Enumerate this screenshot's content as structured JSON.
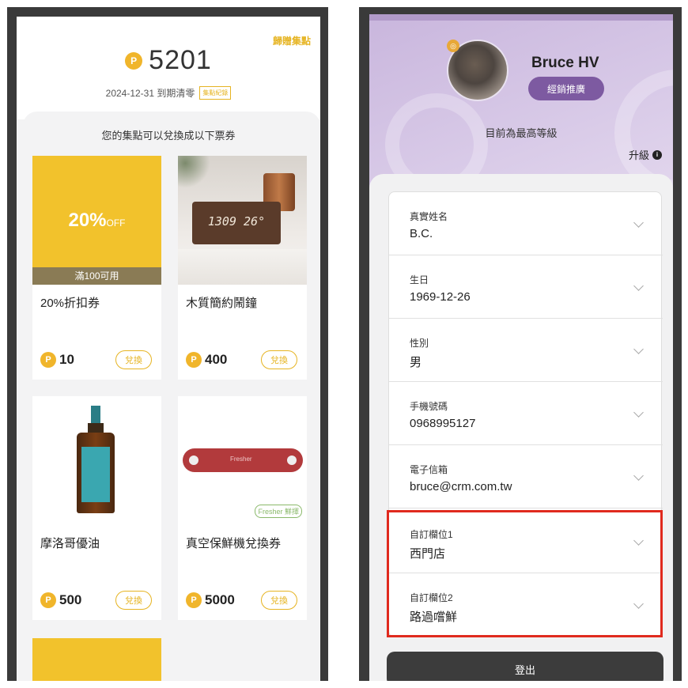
{
  "left": {
    "history_link": "歸贈集點",
    "coin_symbol": "P",
    "points": "5201",
    "expire_text": "2024-12-31 到期清零",
    "record_button": "集點紀錄",
    "subtitle": "您的集點可以兌換成以下票券",
    "coupon_big": "20%",
    "coupon_off": "OFF",
    "coupon_condition": "滿100可用",
    "clock_display": "1309 26°",
    "vac_brand": "Fresher",
    "vac_logo": "Fresher 鮮擇",
    "items": [
      {
        "name": "20%折扣券",
        "price": "10",
        "button": "兌換"
      },
      {
        "name": "木質簡約鬧鐘",
        "price": "400",
        "button": "兌換"
      },
      {
        "name": "摩洛哥優油",
        "price": "500",
        "button": "兌換"
      },
      {
        "name": "真空保鮮機兌換券",
        "price": "5000",
        "button": "兌換"
      }
    ]
  },
  "right": {
    "avatar_badge": "◎",
    "name": "Bruce HV",
    "role_button": "經銷推廣",
    "level_text": "目前為最高等級",
    "upgrade_label": "升級",
    "info_glyph": "i",
    "fields": [
      {
        "label": "真實姓名",
        "value": "B.C."
      },
      {
        "label": "生日",
        "value": "1969-12-26"
      },
      {
        "label": "性別",
        "value": "男"
      },
      {
        "label": "手機號碼",
        "value": "0968995127"
      },
      {
        "label": "電子信箱",
        "value": "bruce@crm.com.tw"
      },
      {
        "label": "自訂欄位1",
        "value": "西門店"
      },
      {
        "label": "自訂欄位2",
        "value": "路過嚐鮮"
      }
    ],
    "logout_button": "登出"
  },
  "colors": {
    "gold": "#e6b422",
    "coin": "#f0b52b",
    "purple": "#7d5aa1",
    "highlight": "#e02a1e",
    "logout_bg": "#3c3c3c"
  }
}
